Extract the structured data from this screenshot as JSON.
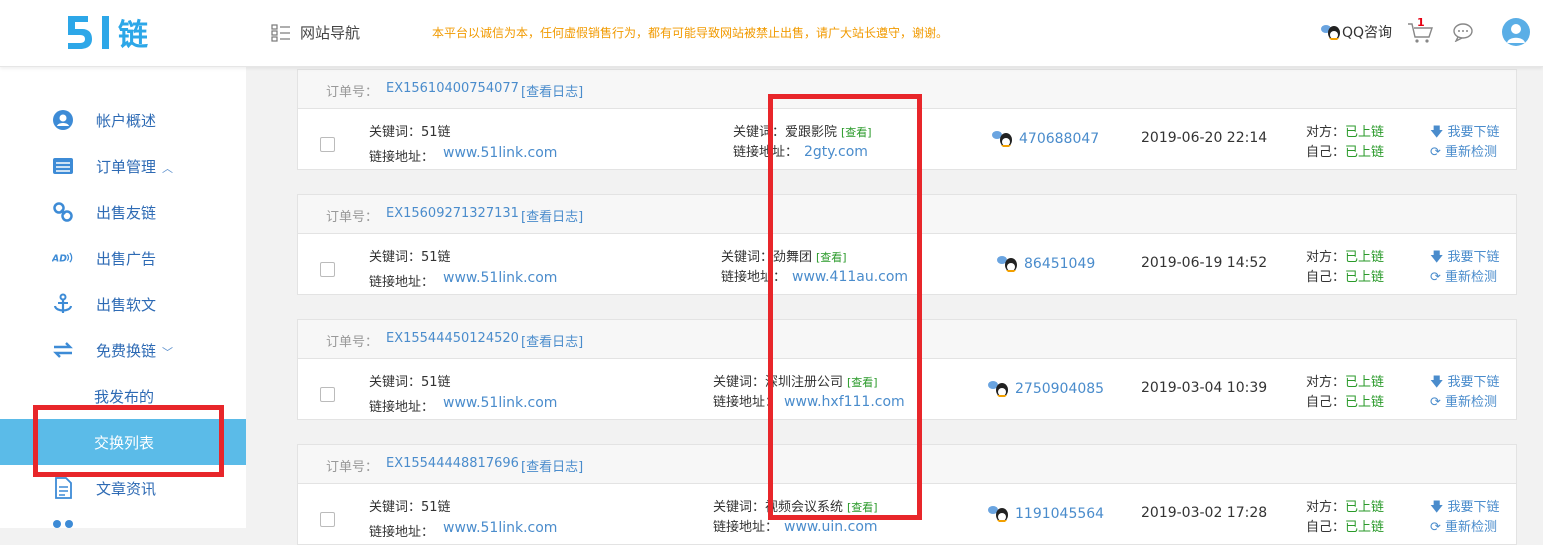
{
  "header": {
    "logo_text": "5 | 链",
    "nav_label": "网站导航",
    "notice": "本平台以诚信为本，任何虚假销售行为，都有可能导致网站被禁止出售，请广大站长遵守，谢谢。",
    "qq_consult": "QQ咨询",
    "cart_count": "1"
  },
  "sidebar": {
    "items": [
      {
        "label": "帐户概述",
        "icon": "user-circle-icon"
      },
      {
        "label": "订单管理",
        "icon": "list-icon",
        "chevron": "^"
      },
      {
        "label": "出售友链",
        "icon": "link-icon"
      },
      {
        "label": "出售广告",
        "icon": "ad-icon"
      },
      {
        "label": "出售软文",
        "icon": "anchor-icon"
      },
      {
        "label": "免费换链",
        "icon": "exchange-icon",
        "chevron": "v"
      }
    ],
    "subitems": [
      {
        "label": "我发布的"
      },
      {
        "label": "交换列表",
        "active": true
      }
    ],
    "bottom_items": [
      {
        "label": "文章资讯",
        "icon": "document-icon"
      }
    ]
  },
  "orders": [
    {
      "order_label": "订单号：",
      "order_no": "EX15610400754077",
      "log_label": "[查看日志]",
      "kw1_label": "关键词：51链",
      "url1_label": "链接地址：",
      "url1": "www.51link.com",
      "kw2_label": "关键词：爱跟影院",
      "view_label": "[查看]",
      "url2_label": "链接地址：",
      "url2": "2gty.com",
      "qq": "470688047",
      "date": "2019-06-20 22:14",
      "other_status_label": "对方：",
      "other_status": "已上链",
      "self_status_label": "自己：",
      "self_status": "已上链",
      "action1": "我要下链",
      "action2": "重新检测"
    },
    {
      "order_label": "订单号：",
      "order_no": "EX15609271327131",
      "log_label": "[查看日志]",
      "kw1_label": "关键词：51链",
      "url1_label": "链接地址：",
      "url1": "www.51link.com",
      "kw2_label": "关键词：劲舞团",
      "view_label": "[查看]",
      "url2_label": "链接地址：",
      "url2": "www.411au.com",
      "qq": "86451049",
      "date": "2019-06-19 14:52",
      "other_status_label": "对方：",
      "other_status": "已上链",
      "self_status_label": "自己：",
      "self_status": "已上链",
      "action1": "我要下链",
      "action2": "重新检测"
    },
    {
      "order_label": "订单号：",
      "order_no": "EX15544450124520",
      "log_label": "[查看日志]",
      "kw1_label": "关键词：51链",
      "url1_label": "链接地址：",
      "url1": "www.51link.com",
      "kw2_label": "关键词：深圳注册公司",
      "view_label": "[查看]",
      "url2_label": "链接地址：",
      "url2": "www.hxf111.com",
      "qq": "2750904085",
      "date": "2019-03-04 10:39",
      "other_status_label": "对方：",
      "other_status": "已上链",
      "self_status_label": "自己：",
      "self_status": "已上链",
      "action1": "我要下链",
      "action2": "重新检测"
    },
    {
      "order_label": "订单号：",
      "order_no": "EX15544448817696",
      "log_label": "[查看日志]",
      "kw1_label": "关键词：51链",
      "url1_label": "链接地址：",
      "url1": "www.51link.com",
      "kw2_label": "关键词：视频会议系统",
      "view_label": "[查看]",
      "url2_label": "链接地址：",
      "url2": "www.uin.com",
      "qq": "1191045564",
      "date": "2019-03-02 17:28",
      "other_status_label": "对方：",
      "other_status": "已上链",
      "self_status_label": "自己：",
      "self_status": "已上链",
      "action1": "我要下链",
      "action2": "重新检测"
    }
  ],
  "colors": {
    "accent": "#5bbbe8",
    "link": "#4a8ccc",
    "status_green": "#2a9a2a",
    "notice_orange": "#f19a00",
    "highlight_red": "#e8262a"
  }
}
